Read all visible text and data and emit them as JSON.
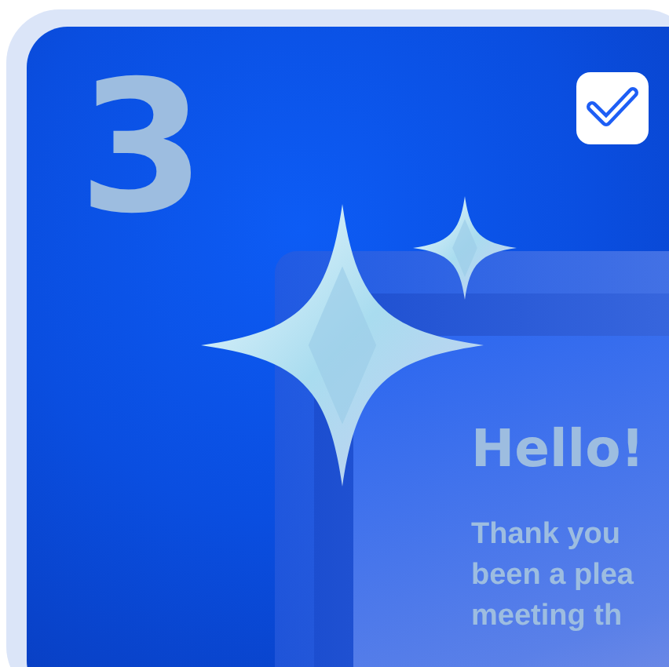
{
  "step_number": "3",
  "checkbox": {
    "checked": true
  },
  "greeting": "Hello!",
  "message_lines": [
    "Thank you",
    "been a plea",
    "meeting th"
  ]
}
